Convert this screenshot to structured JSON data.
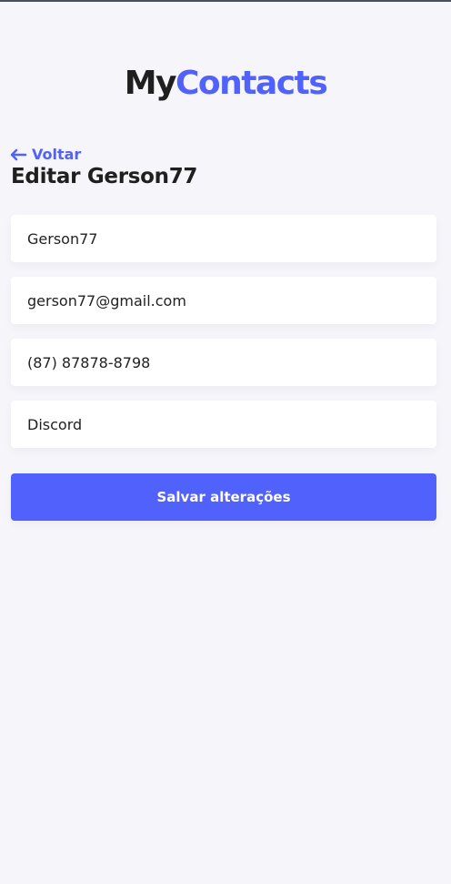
{
  "header": {
    "logo_part1": "My",
    "logo_part2": "Contacts"
  },
  "nav": {
    "back_label": "Voltar",
    "back_icon": "arrow-left-icon"
  },
  "page": {
    "title": "Editar Gerson77"
  },
  "form": {
    "name_value": "Gerson77",
    "email_value": "gerson77@gmail.com",
    "phone_value": "(87) 87878-8798",
    "category_value": "Discord",
    "submit_label": "Salvar alterações"
  },
  "colors": {
    "primary": "#5061fc",
    "background": "#f5f5fa",
    "text": "#1f1f1f"
  }
}
